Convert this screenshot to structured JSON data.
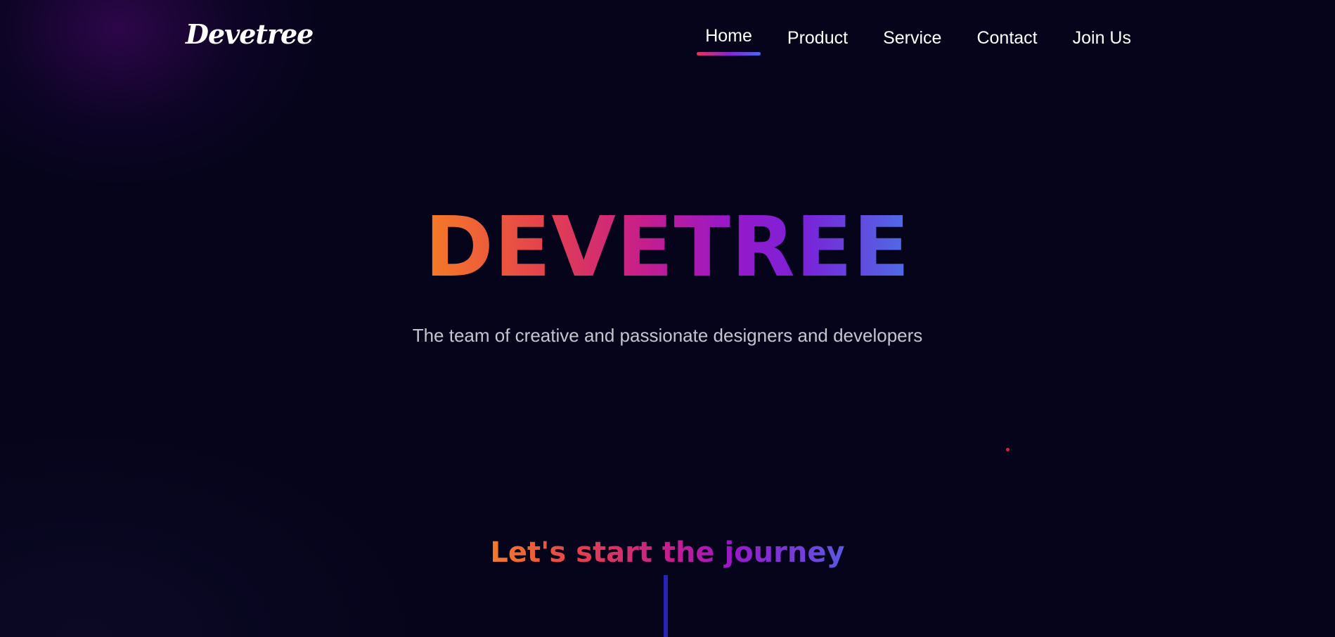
{
  "brand": {
    "logo": "Devetree"
  },
  "nav": {
    "items": [
      {
        "label": "Home",
        "active": true
      },
      {
        "label": "Product",
        "active": false
      },
      {
        "label": "Service",
        "active": false
      },
      {
        "label": "Contact",
        "active": false
      },
      {
        "label": "Join Us",
        "active": false
      }
    ]
  },
  "hero": {
    "title": "DEVETREE",
    "subtitle": "The team of creative and passionate designers and developers"
  },
  "journey": {
    "heading": "Let's start the journey"
  },
  "colors": {
    "background": "#05041a",
    "gradient_start": "#f57c26",
    "gradient_mid": "#c61e8c",
    "gradient_end": "#4d6ee6",
    "timeline": "#2a23b8",
    "accent_dot": "#e0212f"
  }
}
